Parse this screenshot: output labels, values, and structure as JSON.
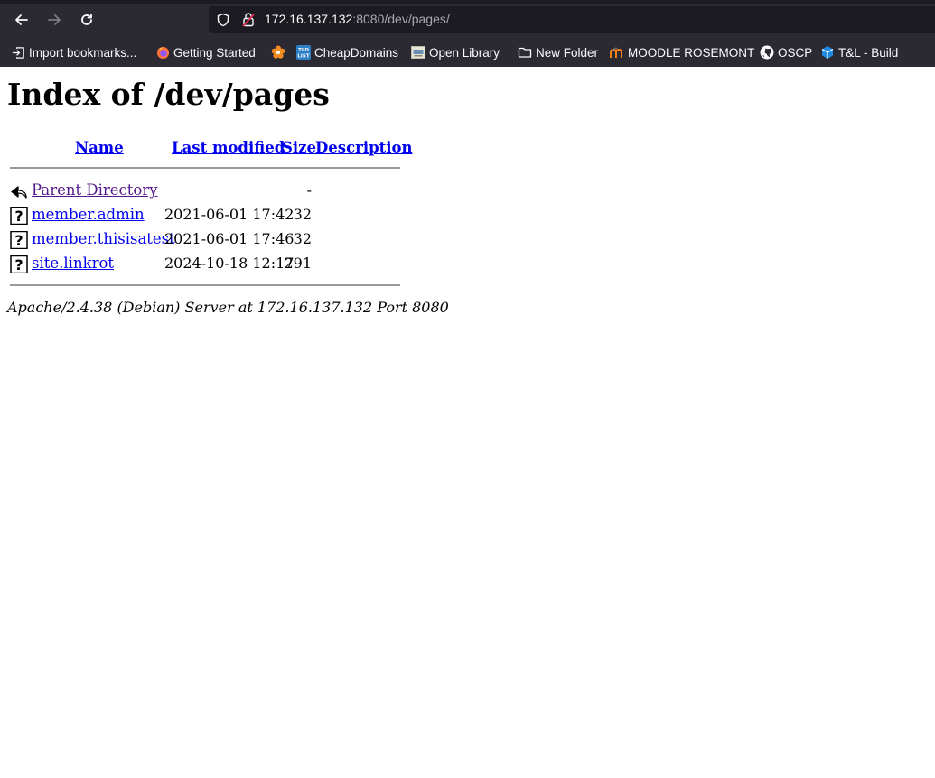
{
  "browser": {
    "url_host": "172.16.137.132",
    "url_rest": ":8080/dev/pages/",
    "bookmarks": [
      {
        "label": "Import bookmarks...",
        "icon": "import-icon"
      },
      {
        "label": "Getting Started",
        "icon": "firefox-icon"
      },
      {
        "label": "",
        "icon": "flower-icon"
      },
      {
        "label": "CheapDomains",
        "icon": "tld-list-icon"
      },
      {
        "label": "Open Library",
        "icon": "open-library-icon"
      },
      {
        "label": "New Folder",
        "icon": "folder-icon"
      },
      {
        "label": "MOODLE ROSEMONT",
        "icon": "moodle-icon"
      },
      {
        "label": "OSCP",
        "icon": "github-icon"
      },
      {
        "label": "T&L - Build",
        "icon": "cube-icon"
      }
    ]
  },
  "page": {
    "title": "Index of /dev/pages",
    "columns": {
      "name": "Name",
      "modified": "Last modified",
      "size": "Size",
      "description": "Description"
    },
    "rows": [
      {
        "name": "Parent Directory",
        "modified": "",
        "size": "-",
        "icon": "back-arrow-icon",
        "visited": true
      },
      {
        "name": "member.admin",
        "modified": "2021-06-01 17:42",
        "size": "32",
        "icon": "unknown-file-icon",
        "visited": false
      },
      {
        "name": "member.thisisatest",
        "modified": "2021-06-01 17:46",
        "size": "32",
        "icon": "unknown-file-icon",
        "visited": false
      },
      {
        "name": "site.linkrot",
        "modified": "2024-10-18 12:17",
        "size": "291",
        "icon": "unknown-file-icon",
        "visited": false
      }
    ],
    "address": "Apache/2.4.38 (Debian) Server at 172.16.137.132 Port 8080"
  },
  "colors": {
    "chrome_bg": "#2b2a33",
    "link": "#0000ee",
    "visited": "#551a8b"
  }
}
